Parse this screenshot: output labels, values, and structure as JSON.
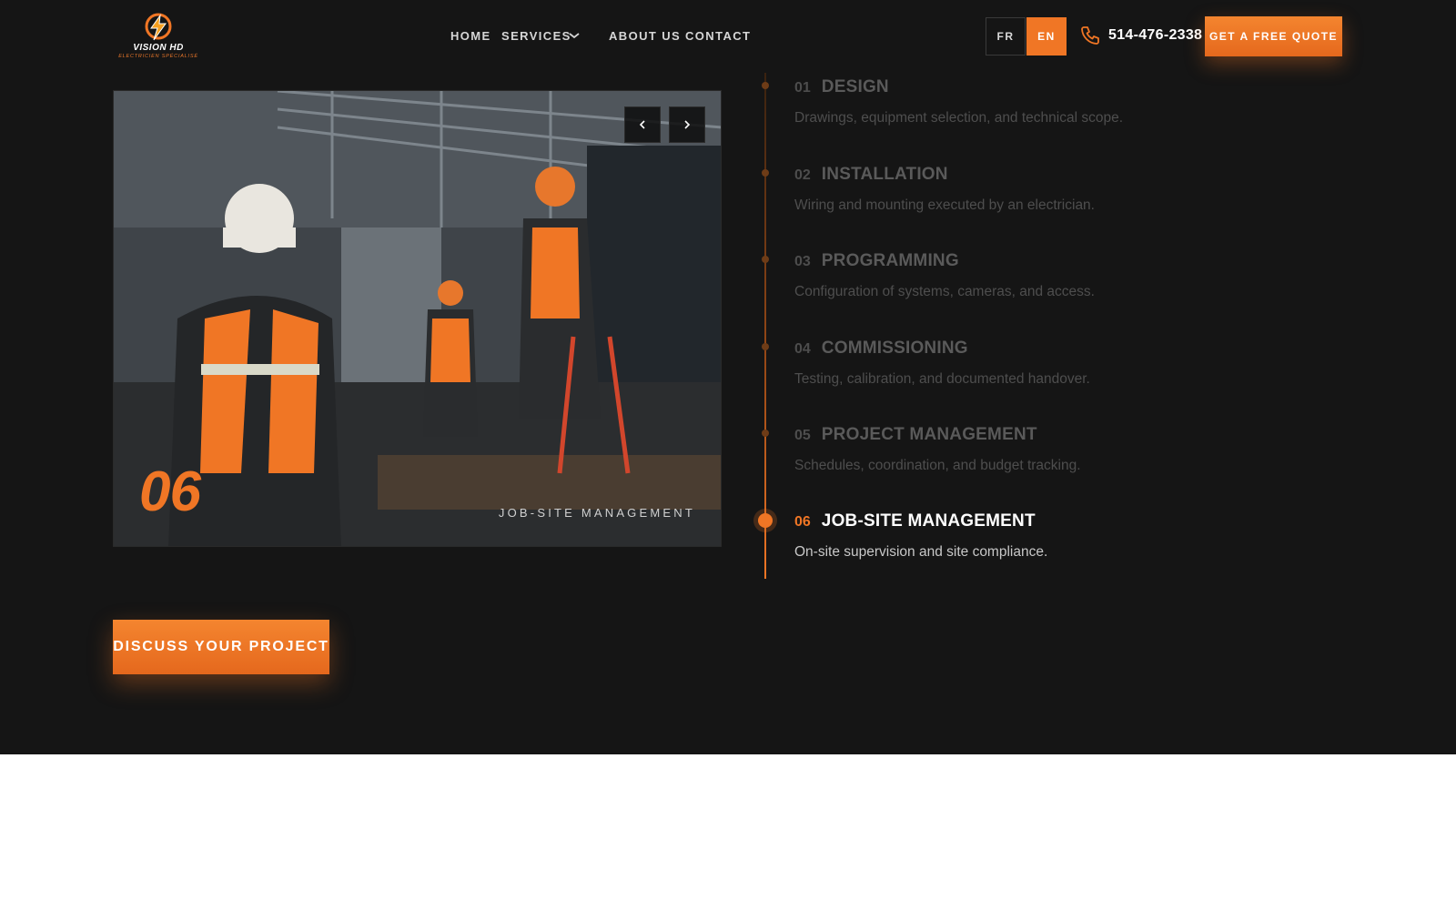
{
  "brand": {
    "name": "VISION HD",
    "tagline": "ELECTRICIEN SPÉCIALISÉ",
    "accent_color": "#f07625",
    "logo_icon": "lightning-bolt-icon"
  },
  "nav": {
    "items": [
      {
        "label": "HOME"
      },
      {
        "label": "SERVICES"
      },
      {
        "label": "ABOUT US"
      },
      {
        "label": "CONTACT"
      }
    ]
  },
  "language": {
    "fr": "FR",
    "en": "EN",
    "active": "EN"
  },
  "contact": {
    "phone": "514-476-2338",
    "phone_icon": "phone-icon"
  },
  "header": {
    "quote_button": "GET A FREE QUOTE"
  },
  "slider": {
    "number": "06",
    "caption": "JOB-SITE MANAGEMENT",
    "prev_icon": "chevron-left-icon",
    "next_icon": "chevron-right-icon"
  },
  "steps": [
    {
      "num": "01",
      "title": "DESIGN",
      "desc": "Drawings, equipment selection, and technical scope."
    },
    {
      "num": "02",
      "title": "INSTALLATION",
      "desc": "Wiring and mounting executed by an electrician."
    },
    {
      "num": "03",
      "title": "PROGRAMMING",
      "desc": "Configuration of systems, cameras, and access."
    },
    {
      "num": "04",
      "title": "COMMISSIONING",
      "desc": "Testing, calibration, and documented handover."
    },
    {
      "num": "05",
      "title": "PROJECT MANAGEMENT",
      "desc": "Schedules, coordination, and budget tracking."
    },
    {
      "num": "06",
      "title": "JOB-SITE MANAGEMENT",
      "desc": "On-site supervision and site compliance."
    }
  ],
  "active_step": "06",
  "cta": {
    "discuss_button": "DISCUSS YOUR PROJECT"
  }
}
